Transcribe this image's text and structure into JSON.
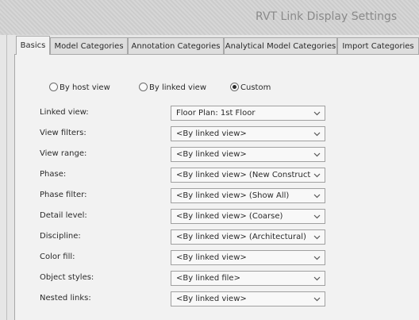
{
  "window": {
    "title": "RVT Link Display Settings"
  },
  "tabs": [
    {
      "label": "Basics",
      "active": true
    },
    {
      "label": "Model Categories",
      "active": false
    },
    {
      "label": "Annotation Categories",
      "active": false
    },
    {
      "label": "Analytical Model Categories",
      "active": false
    },
    {
      "label": "Import Categories",
      "active": false
    }
  ],
  "display_mode": {
    "options": [
      {
        "label": "By host view",
        "selected": false
      },
      {
        "label": "By linked view",
        "selected": false
      },
      {
        "label": "Custom",
        "selected": true
      }
    ]
  },
  "settings": [
    {
      "label": "Linked view:",
      "value": "Floor Plan: 1st Floor"
    },
    {
      "label": "View filters:",
      "value": "<By linked view>"
    },
    {
      "label": "View range:",
      "value": "<By linked view>"
    },
    {
      "label": "Phase:",
      "value": "<By linked view> (New Constructio"
    },
    {
      "label": "Phase filter:",
      "value": "<By linked view> (Show All)"
    },
    {
      "label": "Detail level:",
      "value": "<By linked view> (Coarse)"
    },
    {
      "label": "Discipline:",
      "value": "<By linked view> (Architectural)"
    },
    {
      "label": "Color fill:",
      "value": "<By linked view>"
    },
    {
      "label": "Object styles:",
      "value": "<By linked file>"
    },
    {
      "label": "Nested links:",
      "value": "<By linked view>"
    }
  ]
}
